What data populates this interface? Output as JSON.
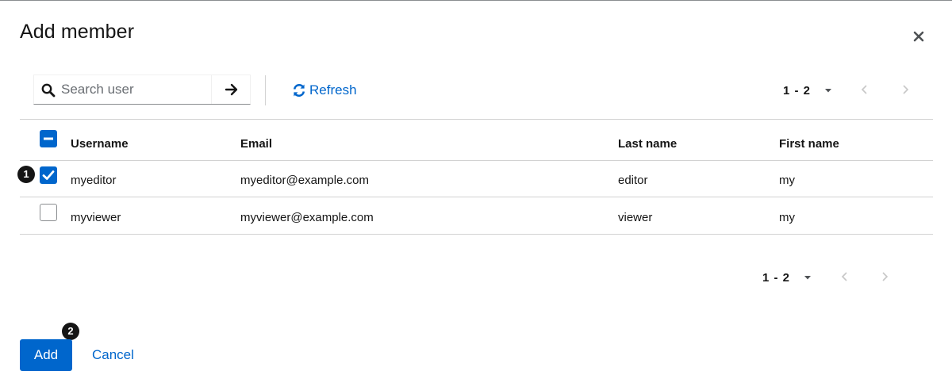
{
  "modal": {
    "title": "Add member"
  },
  "toolbar": {
    "search_placeholder": "Search user",
    "refresh_label": "Refresh",
    "pagination_range": "1 - 2"
  },
  "table": {
    "columns": [
      "Username",
      "Email",
      "Last name",
      "First name"
    ],
    "rows": [
      {
        "username": "myeditor",
        "email": "myeditor@example.com",
        "last_name": "editor",
        "first_name": "my",
        "checked": true
      },
      {
        "username": "myviewer",
        "email": "myviewer@example.com",
        "last_name": "viewer",
        "first_name": "my",
        "checked": false
      }
    ]
  },
  "bottom_pagination": {
    "range": "1 - 2"
  },
  "footer": {
    "add_label": "Add",
    "cancel_label": "Cancel"
  },
  "callouts": [
    "1",
    "2"
  ],
  "colors": {
    "primary": "#0066cc",
    "text": "#151515",
    "border": "#d2d2d2"
  }
}
